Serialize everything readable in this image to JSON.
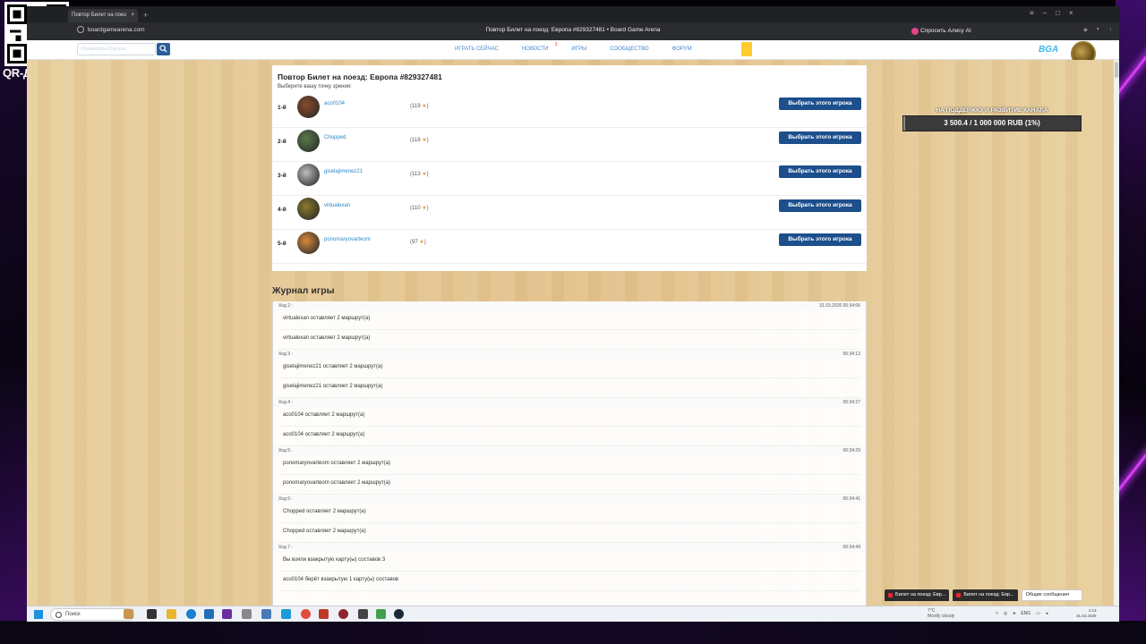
{
  "overlay": {
    "qr_label": "QR-ДОНАТ"
  },
  "browser": {
    "tab_title": "Повтор Билет на поез",
    "tab_close": "×",
    "new_tab": "+",
    "url": "boardgamearena.com",
    "page_title": "Повтор Билет на поезд: Европа #829327481 • Board Game Arena",
    "alice_button": "Спросить Алису AI",
    "controls": {
      "minimize": "–",
      "maximize": "□",
      "close": "×"
    }
  },
  "site": {
    "search_placeholder": "Игрок/Игры/Группы",
    "menu": [
      {
        "label": "Играть сейчас"
      },
      {
        "label": "Новости",
        "badge": "3"
      },
      {
        "label": "Игры"
      },
      {
        "label": "Сообщество"
      },
      {
        "label": "Форум"
      }
    ],
    "logo": "BGA"
  },
  "replay": {
    "title": "Повтор Билет на поезд: Европа #829327481",
    "subtitle": "Выберите вашу точку зрения:",
    "button_label": "Выбрать этого игрока",
    "players": [
      {
        "rank": "1-й",
        "name": "aco0104",
        "elo": "(119",
        "elo_close": ")",
        "avatar_color": "#8a4a2a"
      },
      {
        "rank": "2-й",
        "name": "Chopped",
        "elo": "(118",
        "elo_close": ")",
        "avatar_color": "#5a7a4a"
      },
      {
        "rank": "3-й",
        "name": "giselajimenez21",
        "elo": "(113",
        "elo_close": ")",
        "avatar_color": "#bdbdbd"
      },
      {
        "rank": "4-й",
        "name": "virtualexan",
        "elo": "(110",
        "elo_close": ")",
        "avatar_color": "#8a7a2a"
      },
      {
        "rank": "5-й",
        "name": "ponomaryovarteom",
        "elo": "(97",
        "elo_close": ")",
        "avatar_color": "#d88a3a"
      }
    ]
  },
  "journal": {
    "title": "Журнал игры",
    "moves": [
      {
        "move": "Ход 2 :",
        "time": "31.03.2026 00:34:06",
        "lines": [
          "virtualexan оставляет 2 маршрут(а)",
          "virtualexan оставляет 2 маршрут(а)"
        ]
      },
      {
        "move": "Ход 3 :",
        "time": "00:34:12",
        "lines": [
          "giselajimenez21 оставляет 2 маршрут(а)",
          "giselajimenez21 оставляет 2 маршрут(а)"
        ]
      },
      {
        "move": "Ход 4 :",
        "time": "00:34:27",
        "lines": [
          "aco0104 оставляет 2 маршрут(а)",
          "aco0104 оставляет 2 маршрут(а)"
        ]
      },
      {
        "move": "Ход 5 :",
        "time": "00:34:29",
        "lines": [
          "ponomaryovarteom оставляет 2 маршрут(а)",
          "ponomaryovarteom оставляет 2 маршрут(а)"
        ]
      },
      {
        "move": "Ход 6 :",
        "time": "00:34:41",
        "lines": [
          "Chopped оставляет 2 маршрут(а)",
          "Chopped оставляет 2 маршрут(а)"
        ]
      },
      {
        "move": "Ход 7 :",
        "time": "00:34:49",
        "lines": [
          "Вы взяли взакрытую карту(ы) составов 3",
          "aco0104 берёт взакрытую 1 карту(ы) составов"
        ]
      }
    ]
  },
  "donation": {
    "label": "НА ПОДДЕРЖКУ И РАЗВИТИЕ КАНАЛА",
    "value": "3 500.4 / 1 000 000 RUB (1%)",
    "progress_fraction": 0.0035
  },
  "chat_tabs": [
    "Билет на поезд: Евр...",
    "Билет на поезд: Евр...",
    "Общие сообщения"
  ],
  "taskbar": {
    "search": "Поиск",
    "weather_temp": "7°C",
    "weather_desc": "Mostly cloudy",
    "lang": "ENG",
    "time": "1:13",
    "date": "31.03.2026"
  }
}
